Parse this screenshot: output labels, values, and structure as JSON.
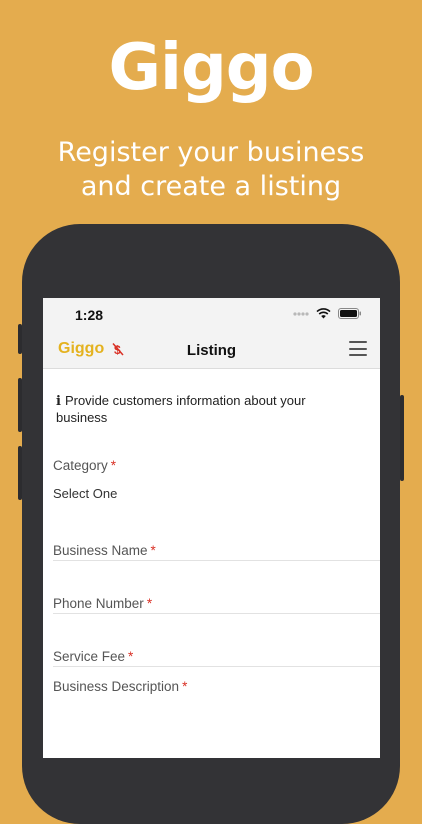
{
  "hero": {
    "title": "Giggo",
    "subtitle_line1": "Register your business",
    "subtitle_line2": "and create a listing"
  },
  "status_bar": {
    "time": "1:28"
  },
  "navbar": {
    "logo": "Giggo",
    "title": "Listing"
  },
  "info_text": "Provide customers information about your business",
  "form": {
    "category": {
      "label": "Category",
      "required": "*",
      "value": "Select One"
    },
    "business_name": {
      "label": "Business Name",
      "required": "*"
    },
    "phone_number": {
      "label": "Phone Number",
      "required": "*"
    },
    "service_fee": {
      "label": "Service Fee",
      "required": "*"
    },
    "business_description": {
      "label": "Business Description",
      "required": "*"
    }
  },
  "colors": {
    "background": "#E4AC4E",
    "brand": "#E4B21F",
    "required": "#D93025"
  }
}
